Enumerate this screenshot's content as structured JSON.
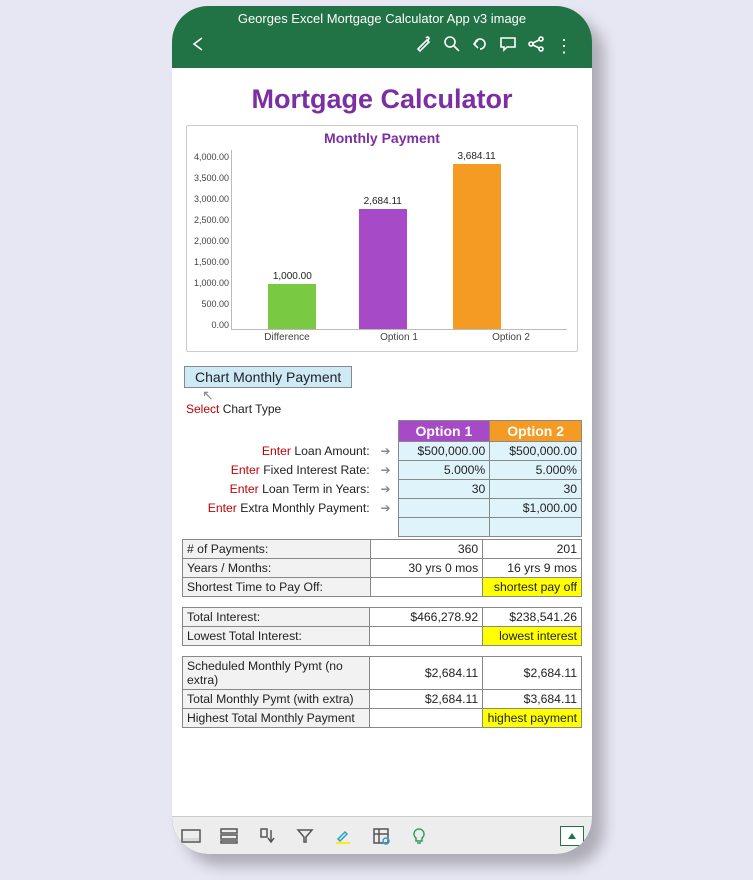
{
  "titlebar": "Georges Excel Mortgage Calculator App v3 image",
  "main_heading": "Mortgage Calculator",
  "chart_data": {
    "type": "bar",
    "title": "Monthly Payment",
    "categories": [
      "Difference",
      "Option 1",
      "Option 2"
    ],
    "values": [
      1000.0,
      2684.11,
      3684.11
    ],
    "value_labels": [
      "1,000.00",
      "2,684.11",
      "3,684.11"
    ],
    "y_ticks": [
      "4,000.00",
      "3,500.00",
      "3,000.00",
      "2,500.00",
      "2,000.00",
      "1,500.00",
      "1,000.00",
      "500.00",
      "0.00"
    ],
    "ylim": [
      0,
      4000
    ],
    "colors": [
      "#7AC943",
      "#A74AC7",
      "#F59B23"
    ]
  },
  "chart_type_selector": "Chart Monthly Payment",
  "select_label_prefix": "Select",
  "select_label_rest": " Chart Type",
  "input_rows": [
    {
      "prefix": "Enter",
      "rest": " Loan Amount:",
      "o1": "$500,000.00",
      "o2": "$500,000.00"
    },
    {
      "prefix": "Enter",
      "rest": " Fixed Interest Rate:",
      "o1": "5.000%",
      "o2": "5.000%"
    },
    {
      "prefix": "Enter",
      "rest": " Loan Term in Years:",
      "o1": "30",
      "o2": "30"
    },
    {
      "prefix": "Enter",
      "rest": " Extra Monthly Payment:",
      "o1": "",
      "o2": "$1,000.00"
    }
  ],
  "headers": {
    "o1": "Option 1",
    "o2": "Option 2"
  },
  "section2": [
    {
      "label": "# of Payments:",
      "o1": "360",
      "o2": "201"
    },
    {
      "label": "Years / Months:",
      "o1": "30 yrs 0 mos",
      "o2": "16 yrs 9 mos"
    },
    {
      "label": "Shortest Time to Pay Off:",
      "o1": "",
      "o2": "shortest pay off",
      "hl": "o2"
    }
  ],
  "section3": [
    {
      "label": "Total Interest:",
      "o1": "$466,278.92",
      "o2": "$238,541.26"
    },
    {
      "label": "Lowest Total Interest:",
      "o1": "",
      "o2": "lowest interest",
      "hl": "o2"
    }
  ],
  "section4": [
    {
      "label": "Scheduled Monthly Pymt (no extra)",
      "o1": "$2,684.11",
      "o2": "$2,684.11"
    },
    {
      "label": "Total Monthly Pymt (with extra)",
      "o1": "$2,684.11",
      "o2": "$3,684.11"
    },
    {
      "label": "Highest Total Monthly Payment",
      "o1": "",
      "o2": "highest payment",
      "hl": "o2"
    }
  ]
}
